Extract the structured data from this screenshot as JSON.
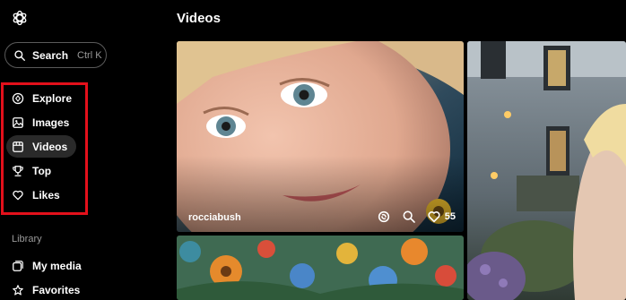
{
  "header": {
    "title": "Videos"
  },
  "search": {
    "label": "Search",
    "shortcut": "Ctrl K"
  },
  "nav": {
    "items": [
      {
        "label": "Explore",
        "icon": "compass-icon"
      },
      {
        "label": "Images",
        "icon": "image-icon"
      },
      {
        "label": "Videos",
        "icon": "film-icon",
        "active": true
      },
      {
        "label": "Top",
        "icon": "trophy-icon"
      },
      {
        "label": "Likes",
        "icon": "heart-icon"
      }
    ]
  },
  "library": {
    "heading": "Library",
    "items": [
      {
        "label": "My media",
        "icon": "media-icon"
      },
      {
        "label": "Favorites",
        "icon": "star-icon"
      }
    ]
  },
  "feed": {
    "cards": [
      {
        "author": "rocciabush",
        "likes": "55"
      }
    ]
  },
  "colors": {
    "background": "#000000",
    "highlight": "#e3101b",
    "active_nav": "#2a2a2a"
  }
}
